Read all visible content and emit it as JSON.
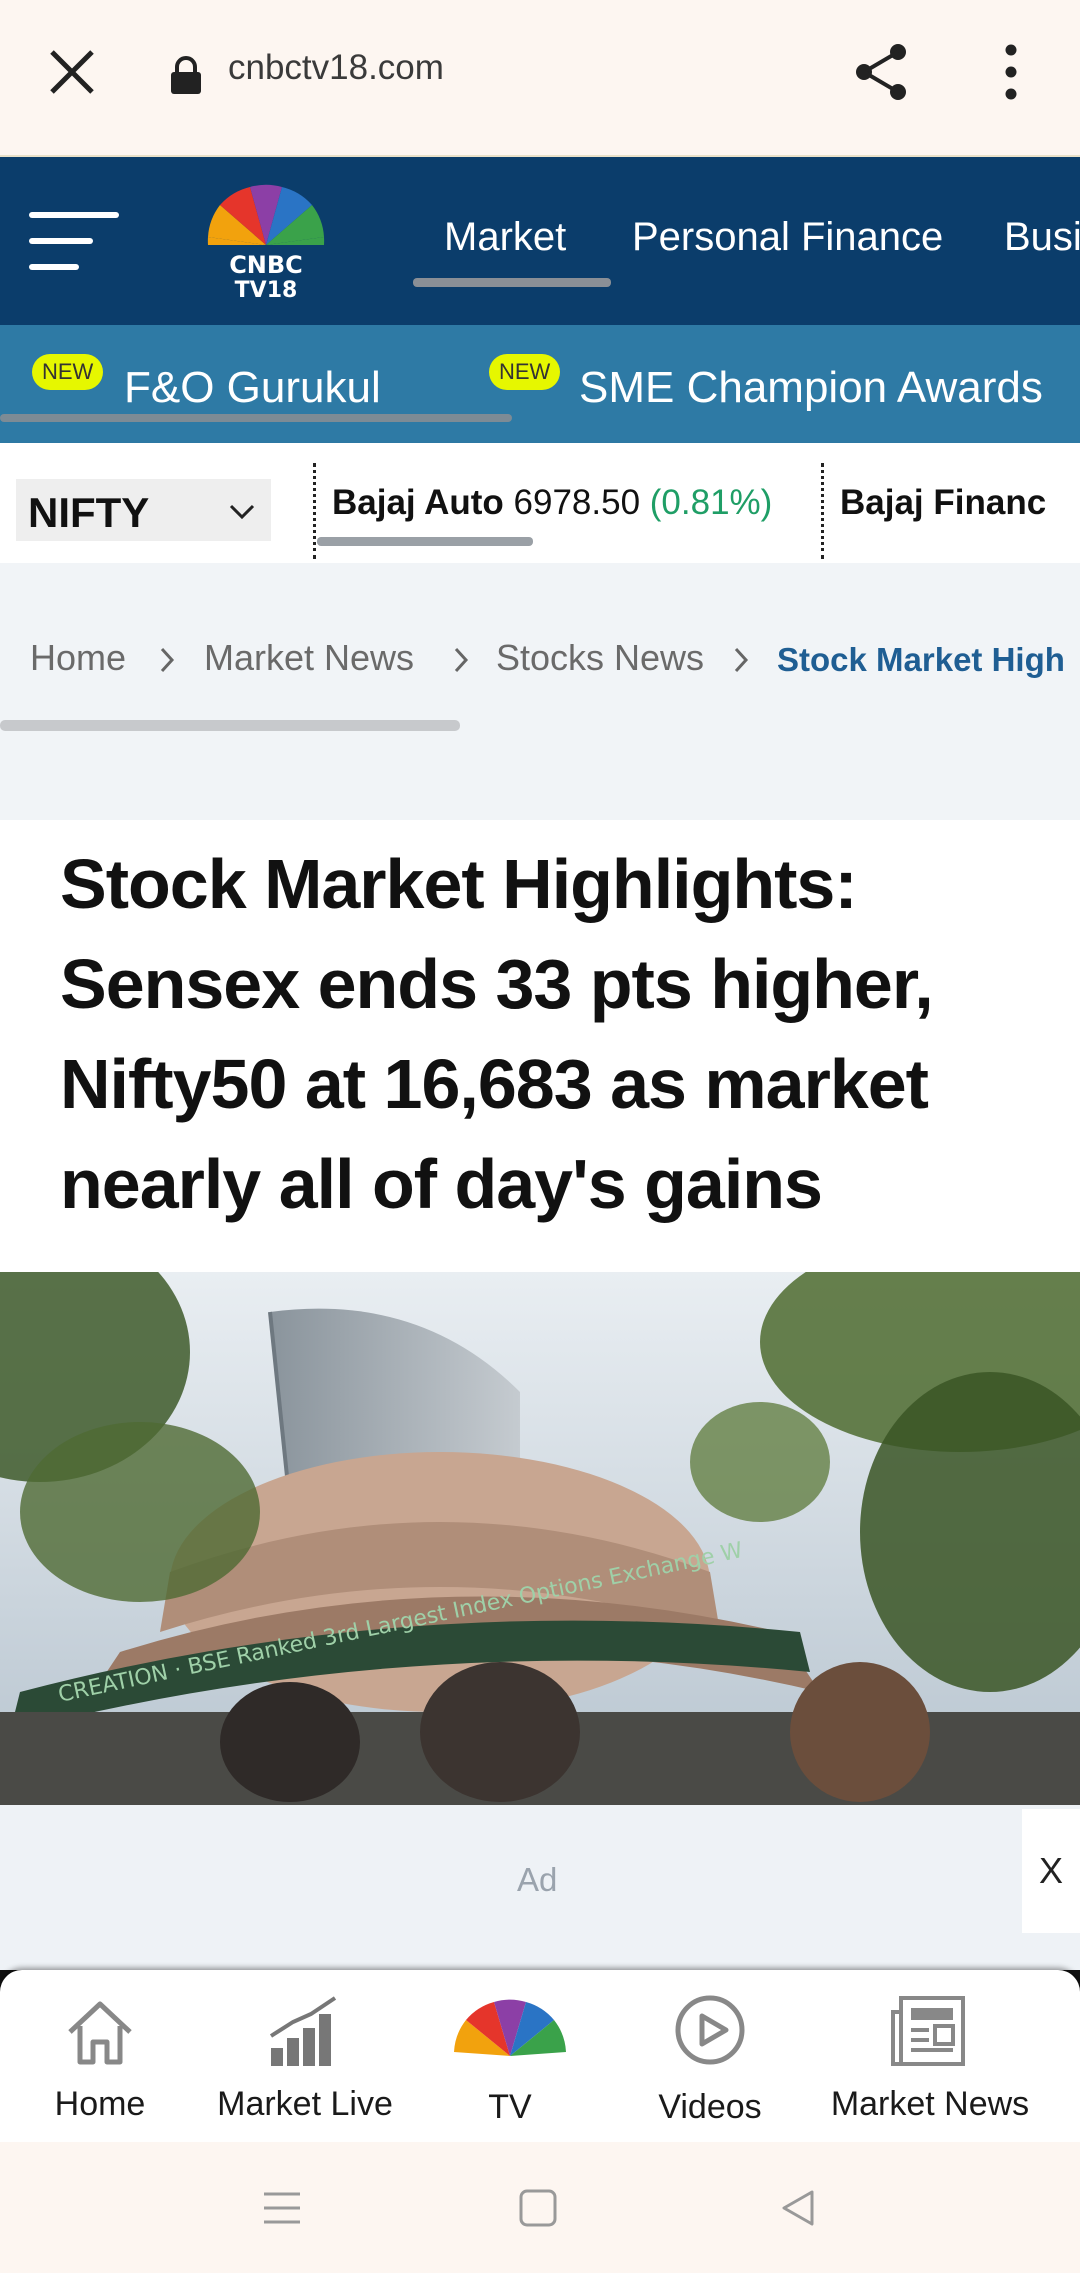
{
  "browser": {
    "url": "cnbctv18.com",
    "icons": [
      "close-icon",
      "lock-icon",
      "share-icon",
      "more-vert-icon"
    ]
  },
  "navbar": {
    "logo_text_line1": "CNBC",
    "logo_text_line2": "TV18",
    "items": [
      {
        "label": "Market",
        "active": true
      },
      {
        "label": "Personal Finance"
      },
      {
        "label": "Busi"
      }
    ]
  },
  "subnav": {
    "items": [
      {
        "badge": "NEW",
        "label": "F&O Gurukul"
      },
      {
        "badge": "NEW",
        "label": "SME Champion Awards"
      }
    ]
  },
  "ticker": {
    "index": "NIFTY",
    "stocks": [
      {
        "name": "Bajaj Auto",
        "price": "6978.50",
        "change": "(0.81%)"
      },
      {
        "name": "Bajaj Financ"
      }
    ],
    "change_color": "#1f9e66"
  },
  "breadcrumb": {
    "items": [
      "Home",
      "Market News",
      "Stocks News",
      "Stock Market High"
    ]
  },
  "article": {
    "headline": "Stock Market Highlights: Sensex ends 33 pts higher, Nifty50 at 16,683 as market nearly all of day's gains",
    "hero_sign": "CREATION · BSE Ranked 3rd Largest Index Options Exchange W"
  },
  "ad": {
    "label": "Ad",
    "close": "X"
  },
  "bottom_nav": {
    "items": [
      {
        "label": "Home",
        "icon": "home-icon"
      },
      {
        "label": "Market Live",
        "icon": "bar-chart-icon"
      },
      {
        "label": "TV",
        "icon": "peacock-icon"
      },
      {
        "label": "Videos",
        "icon": "play-circle-icon"
      },
      {
        "label": "Market News",
        "icon": "newspaper-icon"
      }
    ]
  },
  "colors": {
    "navbar": "#0b3d6b",
    "subnav": "#2e7aa5",
    "badge": "#e6f700",
    "breadcrumb_active": "#1f5e93"
  }
}
